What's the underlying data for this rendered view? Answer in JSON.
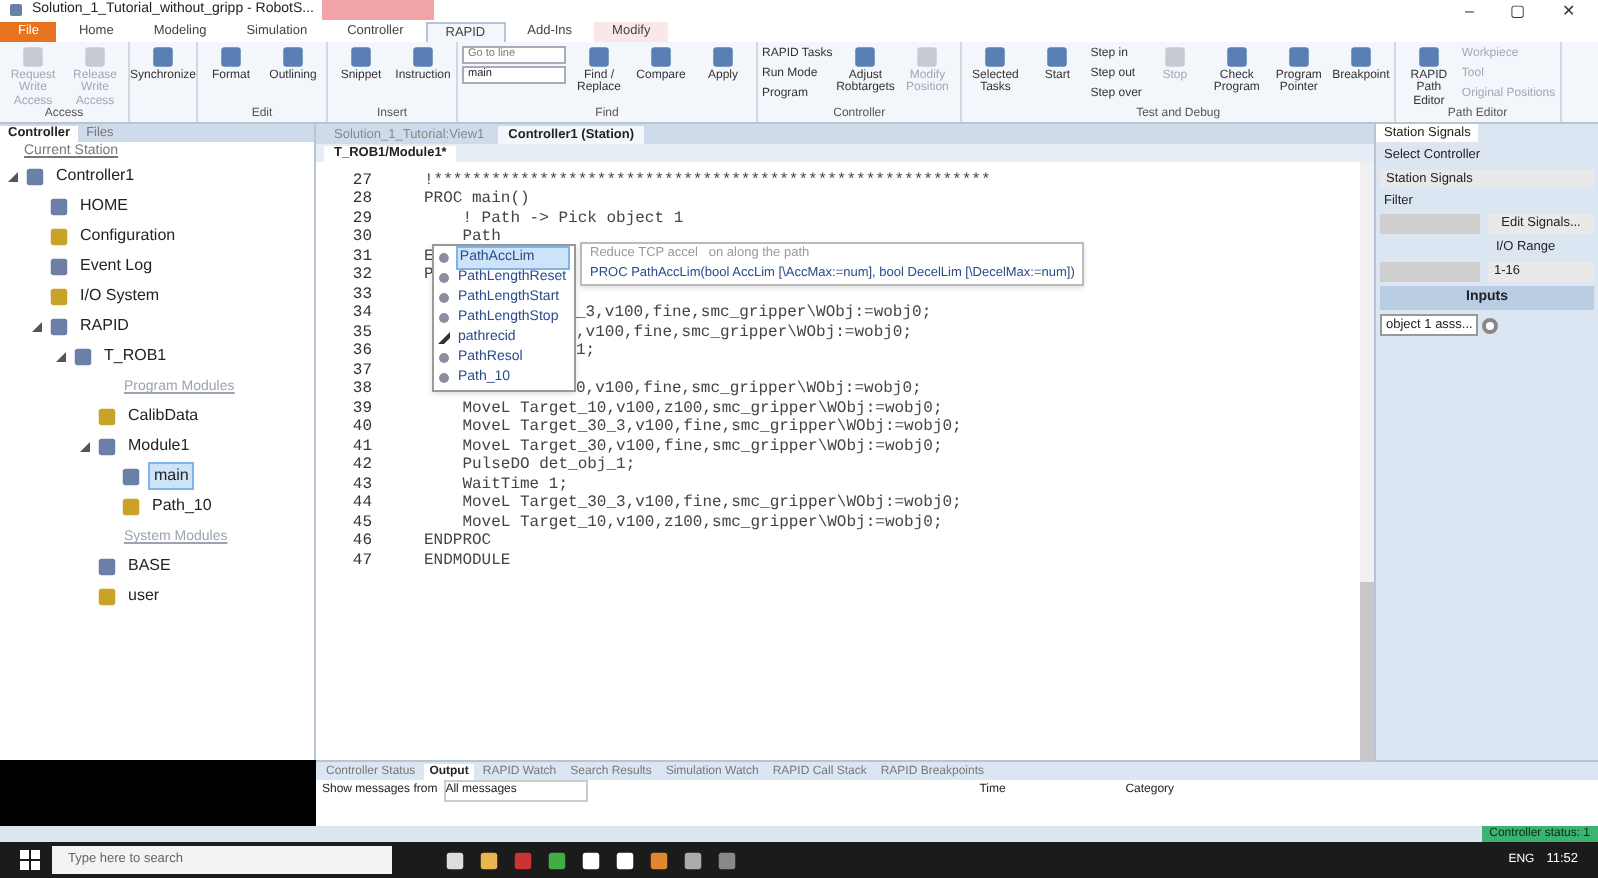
{
  "window": {
    "title": "Solution_1_Tutorial_without_gripp - RobotS...",
    "controls": [
      "–",
      "▢",
      "✕"
    ]
  },
  "ribbon_tabs": [
    {
      "label": "File",
      "kind": "file",
      "selected": false
    },
    {
      "label": "Home",
      "kind": "tab",
      "selected": false
    },
    {
      "label": "Modeling",
      "kind": "tab",
      "selected": false
    },
    {
      "label": "Simulation",
      "kind": "tab",
      "selected": false
    },
    {
      "label": "Controller",
      "kind": "tab",
      "selected": false
    },
    {
      "label": "RAPID",
      "kind": "tab",
      "selected": true
    },
    {
      "label": "Add-Ins",
      "kind": "tab",
      "selected": false
    },
    {
      "label": "Modify",
      "kind": "contextual",
      "selected": false
    }
  ],
  "ribbon_groups": [
    {
      "title": "Access",
      "items": [
        {
          "label": "Request Write Access",
          "kind": "large",
          "disabled": true
        },
        {
          "label": "Release Write Access",
          "kind": "large",
          "disabled": true
        }
      ]
    },
    {
      "items": [
        {
          "label": "Synchronize",
          "kind": "large",
          "disabled": false
        }
      ]
    },
    {
      "title": "Edit",
      "items": [
        {
          "label": "Format",
          "kind": "large",
          "disabled": false
        },
        {
          "label": "Outlining",
          "kind": "large",
          "disabled": false
        }
      ]
    },
    {
      "title": "Insert",
      "items": [
        {
          "label": "Snippet",
          "kind": "large",
          "disabled": false
        },
        {
          "label": "Instruction",
          "kind": "large",
          "disabled": false
        }
      ]
    },
    {
      "title": "Find",
      "items": [
        {
          "label": "Go to line",
          "kind": "field"
        },
        {
          "label": "main",
          "kind": "combo"
        },
        {
          "label": "Find / Replace",
          "kind": "large",
          "disabled": false
        },
        {
          "label": "Compare",
          "kind": "large",
          "disabled": false
        },
        {
          "label": "Apply",
          "kind": "large",
          "disabled": false
        }
      ]
    },
    {
      "title": "Controller",
      "items": [
        {
          "label": "RAPID Tasks",
          "kind": "small",
          "disabled": false
        },
        {
          "label": "Run Mode",
          "kind": "small",
          "disabled": false
        },
        {
          "label": "Program",
          "kind": "small",
          "disabled": false
        },
        {
          "label": "Adjust Robtargets",
          "kind": "large",
          "disabled": false
        },
        {
          "label": "Modify Position",
          "kind": "large",
          "disabled": true
        }
      ]
    },
    {
      "title": "Test and Debug",
      "items": [
        {
          "label": "Selected Tasks",
          "kind": "large",
          "disabled": false
        },
        {
          "label": "Start",
          "kind": "large",
          "disabled": false
        },
        {
          "label": "Step in",
          "kind": "small",
          "disabled": false
        },
        {
          "label": "Step out",
          "kind": "small",
          "disabled": false
        },
        {
          "label": "Step over",
          "kind": "small",
          "disabled": false
        },
        {
          "label": "Stop",
          "kind": "large",
          "disabled": true
        },
        {
          "label": "Check Program",
          "kind": "large",
          "disabled": false
        },
        {
          "label": "Program Pointer",
          "kind": "large",
          "disabled": false
        },
        {
          "label": "Breakpoint",
          "kind": "large",
          "disabled": false
        }
      ]
    },
    {
      "title": "Path Editor",
      "items": [
        {
          "label": "RAPID Path Editor",
          "kind": "large",
          "disabled": false
        },
        {
          "label": "Workpiece",
          "kind": "small",
          "disabled": true
        },
        {
          "label": "Tool",
          "kind": "small",
          "disabled": true
        },
        {
          "label": "Original Positions",
          "kind": "small",
          "disabled": true
        }
      ]
    }
  ],
  "left_panel": {
    "tabs": [
      {
        "label": "Controller",
        "selected": true
      },
      {
        "label": "Files",
        "selected": false
      }
    ],
    "heading": "Current Station",
    "tree": [
      {
        "label": "Controller1",
        "kind": "node",
        "selected": false,
        "children": [
          {
            "label": "HOME",
            "kind": "node",
            "selected": false
          },
          {
            "label": "Configuration",
            "kind": "node",
            "selected": false
          },
          {
            "label": "Event Log",
            "kind": "node",
            "selected": false
          },
          {
            "label": "I/O System",
            "kind": "node",
            "selected": false
          },
          {
            "label": "RAPID",
            "kind": "node",
            "selected": false,
            "children": [
              {
                "label": "T_ROB1",
                "kind": "node",
                "selected": false,
                "children": [
                  {
                    "label": "Program Modules",
                    "kind": "group"
                  },
                  {
                    "label": "CalibData",
                    "kind": "node",
                    "selected": false
                  },
                  {
                    "label": "Module1",
                    "kind": "node",
                    "selected": false,
                    "children": [
                      {
                        "label": "main",
                        "kind": "node",
                        "selected": true
                      },
                      {
                        "label": "Path_10",
                        "kind": "node",
                        "selected": false
                      }
                    ]
                  },
                  {
                    "label": "System Modules",
                    "kind": "group"
                  },
                  {
                    "label": "BASE",
                    "kind": "node",
                    "selected": false
                  },
                  {
                    "label": "user",
                    "kind": "node",
                    "selected": false
                  }
                ]
              }
            ]
          }
        ]
      }
    ]
  },
  "document_tabs": [
    {
      "label": "Solution_1_Tutorial:View1",
      "selected": false
    },
    {
      "label": "Controller1 (Station)",
      "selected": true
    }
  ],
  "editor_tab": {
    "label": "T_ROB1/Module1*"
  },
  "code_lines": [
    {
      "number": "27",
      "kind": "plain",
      "text": "!**********************************************************"
    },
    {
      "number": "28",
      "kind": "plain",
      "text": "PROC main()"
    },
    {
      "number": "29",
      "kind": "plain",
      "text": "    ! Path -> Pick object 1"
    },
    {
      "number": "30",
      "kind": "plain",
      "text": "    Path"
    },
    {
      "number": "31",
      "kind": "covered",
      "prefix": "E"
    },
    {
      "number": "32",
      "kind": "covered",
      "prefix": "P"
    },
    {
      "number": "33",
      "kind": "covered"
    },
    {
      "number": "34",
      "kind": "covered",
      "text": "_3,v100,fine,smc_gripper\\WObj:=wobj0;"
    },
    {
      "number": "35",
      "kind": "covered",
      "text": ",v100,fine,smc_gripper\\WObj:=wobj0;"
    },
    {
      "number": "36",
      "kind": "covered",
      "text": "1;"
    },
    {
      "number": "37",
      "kind": "covered"
    },
    {
      "number": "38",
      "kind": "covered",
      "text": "0,v100,fine,smc_gripper\\WObj:=wobj0;"
    },
    {
      "number": "39",
      "kind": "plain",
      "text": "    MoveL Target_10,v100,z100,smc_gripper\\WObj:=wobj0;"
    },
    {
      "number": "40",
      "kind": "plain",
      "text": "    MoveL Target_30_3,v100,fine,smc_gripper\\WObj:=wobj0;"
    },
    {
      "number": "41",
      "kind": "plain",
      "text": "    MoveL Target_30,v100,fine,smc_gripper\\WObj:=wobj0;"
    },
    {
      "number": "42",
      "kind": "plain",
      "text": "    PulseDO det_obj_1;"
    },
    {
      "number": "43",
      "kind": "plain",
      "text": "    WaitTime 1;"
    },
    {
      "number": "44",
      "kind": "plain",
      "text": "    MoveL Target_30_3,v100,fine,smc_gripper\\WObj:=wobj0;"
    },
    {
      "number": "45",
      "kind": "plain",
      "text": "    MoveL Target_10,v100,z100,smc_gripper\\WObj:=wobj0;"
    },
    {
      "number": "46",
      "kind": "plain",
      "text": "ENDPROC"
    },
    {
      "number": "47",
      "kind": "plain",
      "text": "ENDMODULE"
    }
  ],
  "completion_list": [
    {
      "label": "PathAccLim",
      "kind": "procedure",
      "selected": true
    },
    {
      "label": "PathLengthReset",
      "kind": "procedure",
      "selected": false
    },
    {
      "label": "PathLengthStart",
      "kind": "procedure",
      "selected": false
    },
    {
      "label": "PathLengthStop",
      "kind": "procedure",
      "selected": false
    },
    {
      "label": "pathrecid",
      "kind": "datatype",
      "selected": false
    },
    {
      "label": "PathResol",
      "kind": "procedure",
      "selected": false
    },
    {
      "label": "Path_10",
      "kind": "procedure",
      "selected": false
    }
  ],
  "tooltip": {
    "description": "Reduce TCP accel   on along the path",
    "signature": "PROC PathAccLim(bool AccLim [\\AccMax:=num], bool DecelLim [\\DecelMax:=num])"
  },
  "right_panel": {
    "tab": "Station Signals",
    "select_label": "Select Controller",
    "select_value": "Station Signals",
    "filter_label": "Filter",
    "edit_button": "Edit Signals...",
    "range_label": "I/O Range",
    "range_value": "1-16",
    "section": "Inputs",
    "signal": {
      "label": "object 1 asss...",
      "on": false
    }
  },
  "output_panel": {
    "tabs": [
      {
        "label": "Controller Status",
        "selected": false
      },
      {
        "label": "Output",
        "selected": true
      },
      {
        "label": "RAPID Watch",
        "selected": false
      },
      {
        "label": "Search Results",
        "selected": false
      },
      {
        "label": "Simulation Watch",
        "selected": false
      },
      {
        "label": "RAPID Call Stack",
        "selected": false
      },
      {
        "label": "RAPID Breakpoints",
        "selected": false
      }
    ],
    "filter_label": "Show messages from",
    "filter_value": "All messages",
    "columns": [
      "Time",
      "Category"
    ]
  },
  "status_bar": {
    "text": "Controller status: 1"
  },
  "taskbar": {
    "search_placeholder": "Type here to search",
    "language": "ENG",
    "time": "11:52"
  }
}
